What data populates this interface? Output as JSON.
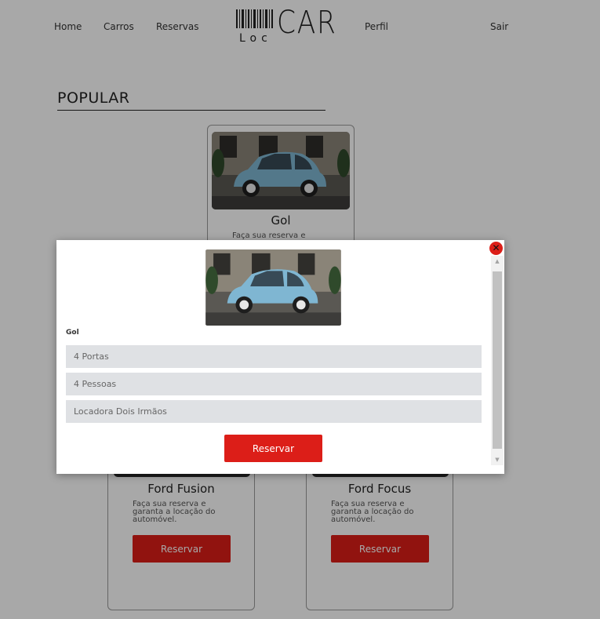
{
  "nav": {
    "home": "Home",
    "cars": "Carros",
    "reservations": "Reservas",
    "profile": "Perfil",
    "logout": "Sair"
  },
  "logo": {
    "prefix": "Loc",
    "word": "CAR"
  },
  "section": {
    "title": "POPULAR"
  },
  "cards": {
    "gol": {
      "name": "Gol",
      "desc": "Faça sua reserva e"
    },
    "fusion": {
      "name": "Ford Fusion",
      "desc": "Faça sua reserva e garanta a locação do automóvel.",
      "button": "Reservar"
    },
    "focus": {
      "name": "Ford Focus",
      "desc": "Faça sua reserva e garanta a locação do automóvel.",
      "button": "Reservar"
    }
  },
  "modal": {
    "car_name": "Gol",
    "specs": [
      "4 Portas",
      "4 Pessoas",
      "Locadora Dois Irmãos"
    ],
    "button": "Reservar",
    "close_glyph": "✕"
  },
  "colors": {
    "accent": "#dc1e18",
    "spec_bg": "#dfe1e4",
    "car": "#7fb6d2"
  }
}
